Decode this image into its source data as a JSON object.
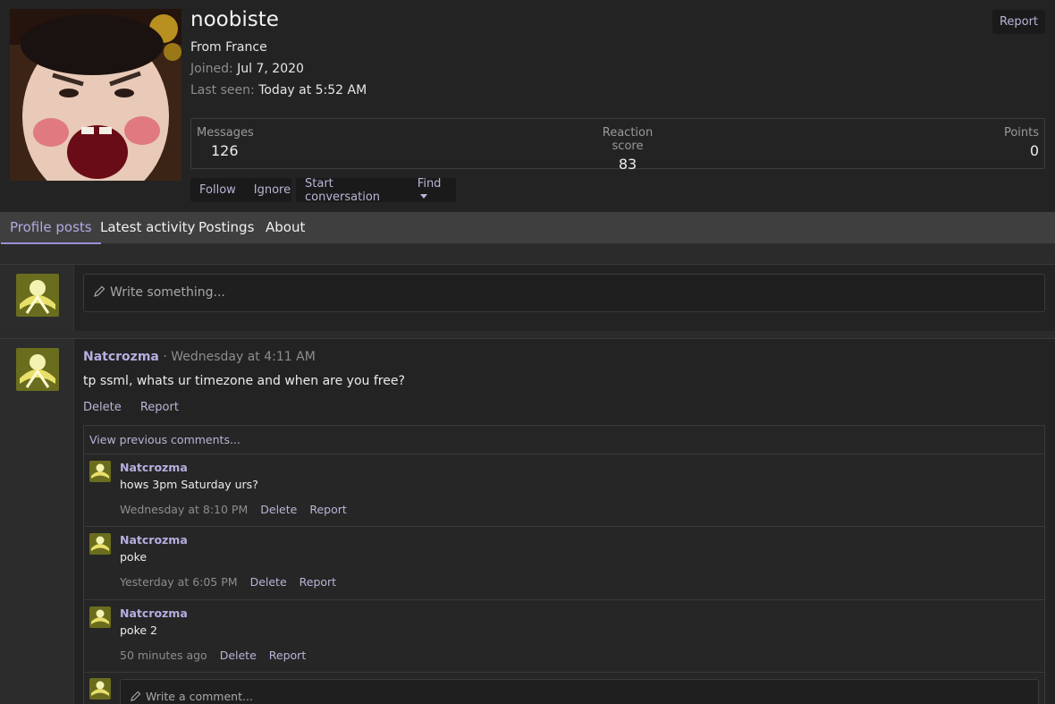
{
  "profile": {
    "username": "noobiste",
    "location": "From France",
    "joined_label": "Joined:",
    "joined_value": "Jul 7, 2020",
    "last_seen_label": "Last seen:",
    "last_seen_value": "Today at 5:52 AM",
    "report_label": "Report"
  },
  "stats": [
    {
      "label": "Messages",
      "value": "126"
    },
    {
      "label": "Reaction score",
      "value": "83"
    },
    {
      "label": "Points",
      "value": "0"
    }
  ],
  "actions": {
    "follow": "Follow",
    "ignore": "Ignore",
    "start_conversation": "Start conversation",
    "find": "Find"
  },
  "tabs": [
    {
      "label": "Profile posts",
      "active": true
    },
    {
      "label": "Latest activity",
      "active": false
    },
    {
      "label": "Postings",
      "active": false
    },
    {
      "label": "About",
      "active": false
    }
  ],
  "composer": {
    "placeholder": "Write something..."
  },
  "post": {
    "author": "Natcrozma",
    "meta": " · Wednesday at 4:11 AM",
    "text": "tp ssml, whats ur timezone and when are you free?",
    "delete": "Delete",
    "report": "Report"
  },
  "comments_block": {
    "view_previous": "View previous comments...",
    "items": [
      {
        "author": "Natcrozma",
        "text": "hows 3pm Saturday urs?",
        "time": "Wednesday at 8:10 PM",
        "delete": "Delete",
        "report": "Report"
      },
      {
        "author": "Natcrozma",
        "text": "poke",
        "time": "Yesterday at 6:05 PM",
        "delete": "Delete",
        "report": "Report"
      },
      {
        "author": "Natcrozma",
        "text": "poke 2",
        "time": "50 minutes ago",
        "delete": "Delete",
        "report": "Report"
      }
    ],
    "write_comment_placeholder": "Write a comment..."
  },
  "colors": {
    "accent": "#b5aee0",
    "background": "#232323",
    "tab_bar": "#3f3f3f"
  }
}
